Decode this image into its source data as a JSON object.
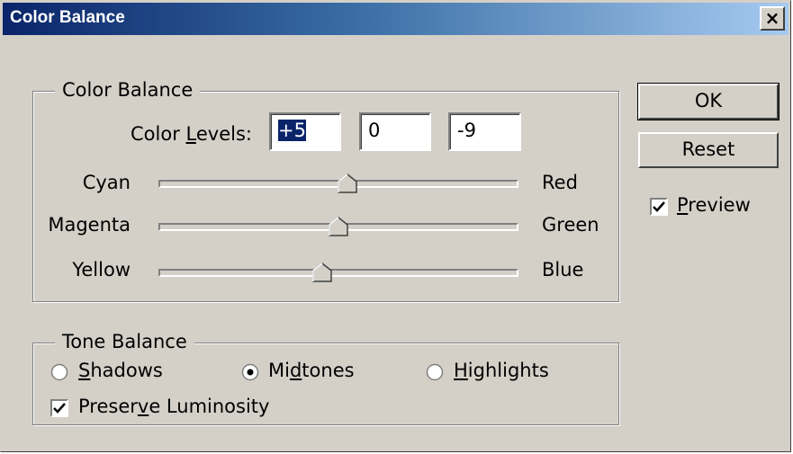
{
  "window": {
    "title": "Color Balance",
    "close_glyph": "×"
  },
  "color_balance": {
    "legend": "Color Balance",
    "levels_label_pre": "Color ",
    "levels_label_u": "L",
    "levels_label_post": "evels:",
    "levels": [
      "+5",
      "0",
      "-9"
    ],
    "sliders": [
      {
        "left": "Cyan",
        "right": "Red",
        "value": 5
      },
      {
        "left": "Magenta",
        "right": "Green",
        "value": 0
      },
      {
        "left": "Yellow",
        "right": "Blue",
        "value": -9
      }
    ]
  },
  "tone_balance": {
    "legend": "Tone Balance",
    "options": [
      {
        "pre": "",
        "u": "S",
        "post": "hadows",
        "selected": false
      },
      {
        "pre": "Mi",
        "u": "d",
        "post": "tones",
        "selected": true
      },
      {
        "pre": "",
        "u": "H",
        "post": "ighlights",
        "selected": false
      }
    ],
    "preserve_pre": "Preser",
    "preserve_u": "v",
    "preserve_post": "e Luminosity",
    "preserve_checked": true
  },
  "buttons": {
    "ok": "OK",
    "reset": "Reset"
  },
  "preview": {
    "u": "P",
    "post": "review",
    "checked": true
  }
}
